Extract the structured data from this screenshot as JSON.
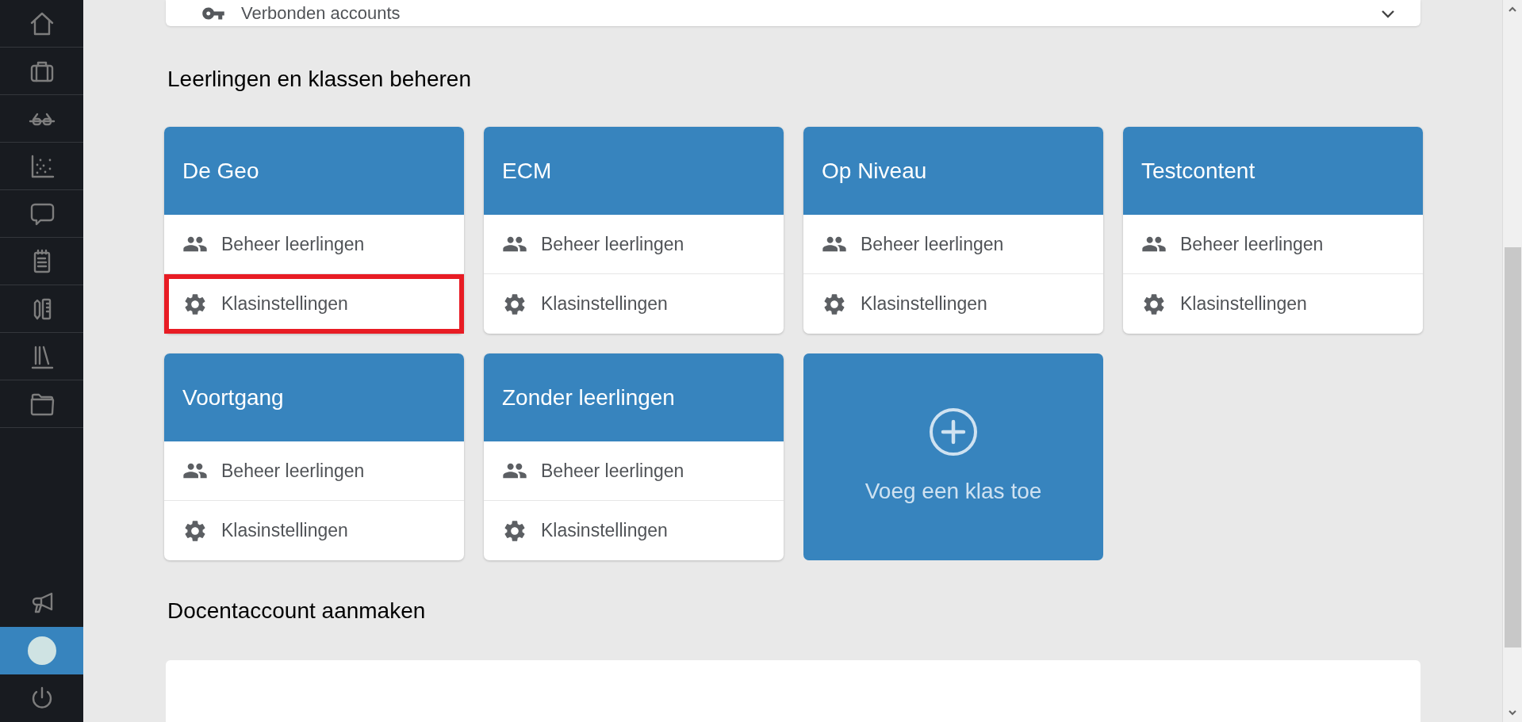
{
  "sidebar": {
    "items": [
      {
        "kind": "home",
        "selected": false
      },
      {
        "kind": "briefcase",
        "selected": false
      },
      {
        "kind": "glasses",
        "selected": false
      },
      {
        "kind": "scatter",
        "selected": false
      },
      {
        "kind": "chat",
        "selected": false
      },
      {
        "kind": "notepad",
        "selected": false
      },
      {
        "kind": "tools",
        "selected": false
      },
      {
        "kind": "library",
        "selected": false
      },
      {
        "kind": "folder",
        "selected": false
      }
    ],
    "bottom_items": [
      {
        "kind": "megaphone",
        "selected": false
      },
      {
        "kind": "avatar",
        "selected": true
      },
      {
        "kind": "power",
        "selected": false
      }
    ]
  },
  "connected_accounts": {
    "label": "Verbonden accounts",
    "expanded": false
  },
  "classes_section": {
    "title": "Leerlingen en klassen beheren",
    "classes": [
      {
        "name": "De Geo",
        "actions": [
          {
            "kind": "students",
            "label": "Beheer leerlingen",
            "highlighted": false
          },
          {
            "kind": "settings",
            "label": "Klasinstellingen",
            "highlighted": true
          }
        ]
      },
      {
        "name": "ECM",
        "actions": [
          {
            "kind": "students",
            "label": "Beheer leerlingen",
            "highlighted": false
          },
          {
            "kind": "settings",
            "label": "Klasinstellingen",
            "highlighted": false
          }
        ]
      },
      {
        "name": "Op Niveau",
        "actions": [
          {
            "kind": "students",
            "label": "Beheer leerlingen",
            "highlighted": false
          },
          {
            "kind": "settings",
            "label": "Klasinstellingen",
            "highlighted": false
          }
        ]
      },
      {
        "name": "Testcontent",
        "actions": [
          {
            "kind": "students",
            "label": "Beheer leerlingen",
            "highlighted": false
          },
          {
            "kind": "settings",
            "label": "Klasinstellingen",
            "highlighted": false
          }
        ]
      },
      {
        "name": "Voortgang",
        "actions": [
          {
            "kind": "students",
            "label": "Beheer leerlingen",
            "highlighted": false
          },
          {
            "kind": "settings",
            "label": "Klasinstellingen",
            "highlighted": false
          }
        ]
      },
      {
        "name": "Zonder leerlingen",
        "actions": [
          {
            "kind": "students",
            "label": "Beheer leerlingen",
            "highlighted": false
          },
          {
            "kind": "settings",
            "label": "Klasinstellingen",
            "highlighted": false
          }
        ]
      }
    ],
    "add_class": {
      "label": "Voeg een klas toe"
    }
  },
  "teacher_section": {
    "title": "Docentaccount aanmaken"
  }
}
